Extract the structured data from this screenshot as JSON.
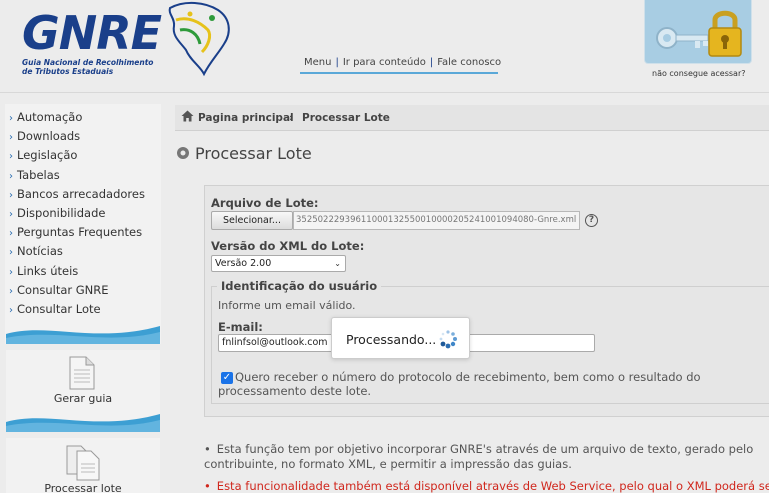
{
  "header": {
    "logo_text": "GNRE",
    "logo_subtitle_line1": "Guia Nacional de Recolhimento",
    "logo_subtitle_line2": "de Tributos Estaduais",
    "nav": [
      "Menu",
      "Ir para conteúdo",
      "Fale conosco"
    ],
    "lock_caption": "não consegue acessar?"
  },
  "sidebar": {
    "items": [
      {
        "label": "Automação"
      },
      {
        "label": "Downloads"
      },
      {
        "label": "Legislação"
      },
      {
        "label": "Tabelas"
      },
      {
        "label": "Bancos arrecadadores"
      },
      {
        "label": "Disponibilidade"
      },
      {
        "label": "Perguntas Frequentes"
      },
      {
        "label": "Notícias"
      },
      {
        "label": "Links úteis"
      },
      {
        "label": "Consultar GNRE"
      },
      {
        "label": "Consultar Lote"
      }
    ],
    "cards": [
      {
        "label": "Gerar guia"
      },
      {
        "label": "Processar lote"
      }
    ]
  },
  "breadcrumb": {
    "home": "Pagina principal",
    "current": "Processar Lote"
  },
  "main": {
    "title": "Processar Lote",
    "file_label": "Arquivo de Lote:",
    "select_button": "Selecionar...",
    "file_value": "35250222939611000132550010000205241001094080-Gnre.xml",
    "help": "?",
    "version_label": "Versão do XML do Lote:",
    "version_value": "Versão 2.00",
    "user_legend": "Identificação do usuário",
    "email_hint": "Informe um email válido.",
    "email_label": "E-mail:",
    "email_value": "fnlinfsol@outlook.com",
    "checkbox_label": "Quero receber o número do protocolo de recebimento, bem como o resultado do processamento deste lote.",
    "checkbox_checked": true,
    "processing_text": "Processando..."
  },
  "notes": {
    "info": "Esta função tem por objetivo incorporar GNRE's através de um arquivo de texto, gerado pelo contribuinte, no formato XML, e permitir a impressão das guias.",
    "warning": "Esta funcionalidade também está disponível através de Web Service, pelo qual o XML poderá ser"
  },
  "colors": {
    "brand_blue": "#1a3f8a",
    "link_blue": "#2a6cb0",
    "wave_blue": "#3d9fd3",
    "warning_red": "#d0271d"
  }
}
